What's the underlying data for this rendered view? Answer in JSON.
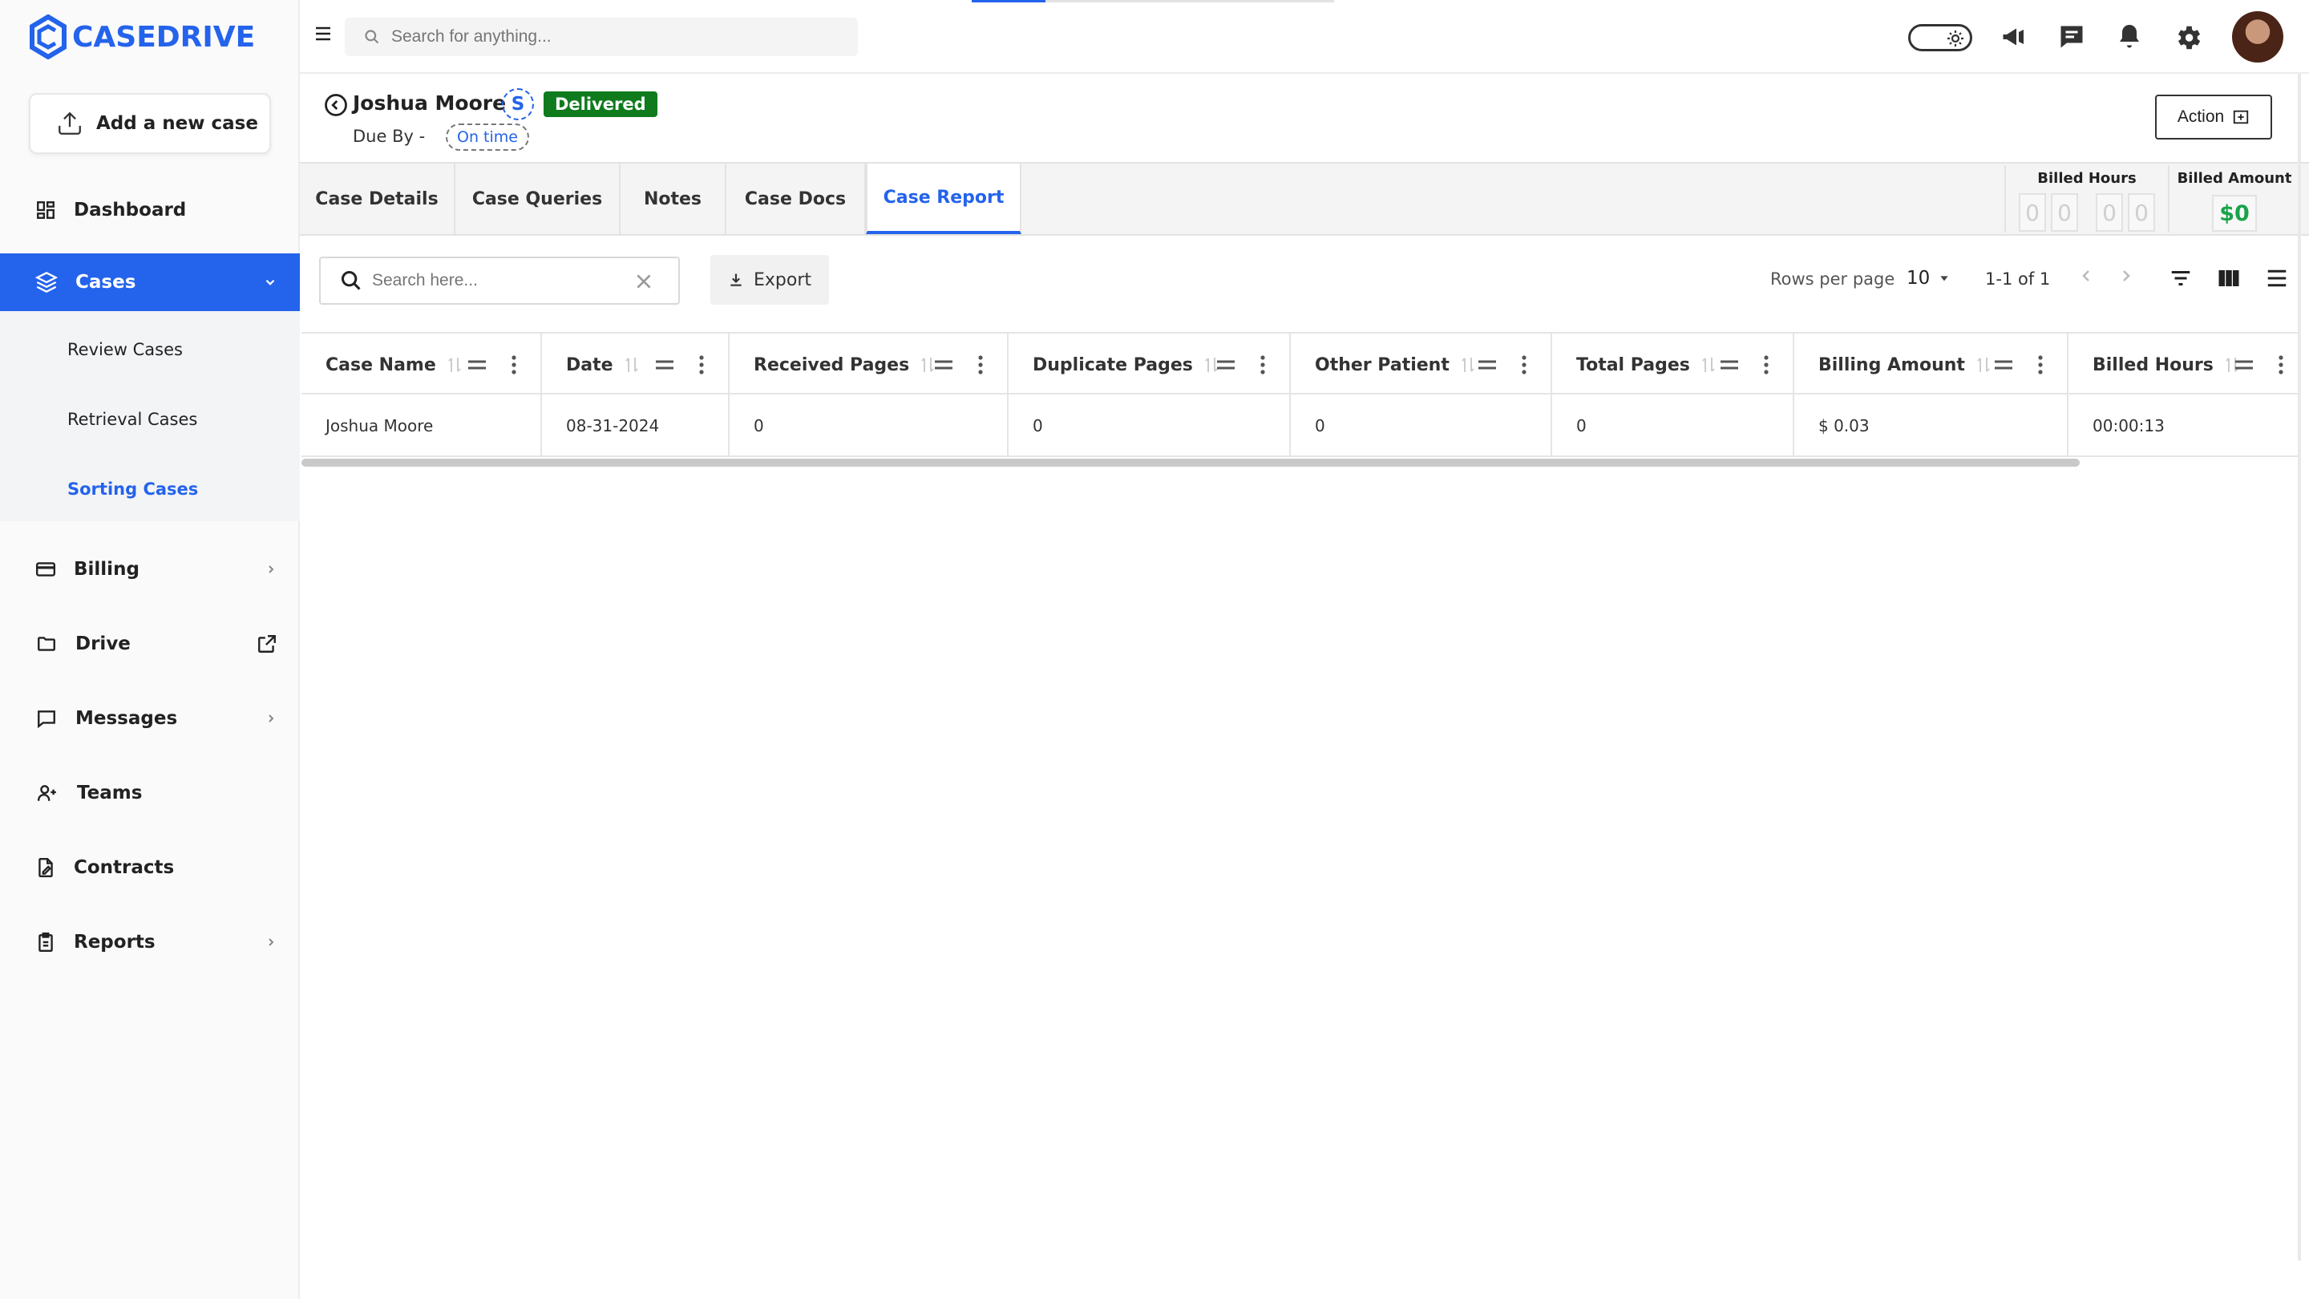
{
  "app": {
    "brand": "CASEDRIVE"
  },
  "sidebar": {
    "add_case_label": "Add a new case",
    "items": [
      {
        "label": "Dashboard",
        "icon": "dashboard-icon"
      },
      {
        "label": "Cases",
        "icon": "layers-icon",
        "active": true
      },
      {
        "label": "Billing",
        "icon": "credit-card-icon"
      },
      {
        "label": "Drive",
        "icon": "folder-icon"
      },
      {
        "label": "Messages",
        "icon": "message-icon"
      },
      {
        "label": "Teams",
        "icon": "users-icon"
      },
      {
        "label": "Contracts",
        "icon": "contract-icon"
      },
      {
        "label": "Reports",
        "icon": "clipboard-icon"
      }
    ],
    "cases_sub": [
      "Review Cases",
      "Retrieval Cases",
      "Sorting Cases"
    ],
    "active_sub": "Sorting Cases"
  },
  "topbar": {
    "search_placeholder": "Search for anything..."
  },
  "case": {
    "name": "Joshua Moore",
    "badge_letter": "S",
    "status": "Delivered",
    "due_by_label": "Due By -",
    "due_status": "On time",
    "action_label": "Action"
  },
  "tabs": [
    "Case Details",
    "Case Queries",
    "Notes",
    "Case Docs",
    "Case Report"
  ],
  "active_tab": "Case Report",
  "billed": {
    "hours_label": "Billed Hours",
    "hours_digits": [
      "0",
      "0",
      "0",
      "0"
    ],
    "amount_label": "Billed Amount",
    "amount_value": "$0"
  },
  "toolbar": {
    "search_placeholder": "Search here...",
    "export_label": "Export",
    "rows_per_page_label": "Rows per page",
    "rows_per_page_value": "10",
    "range_text": "1-1 of 1"
  },
  "table": {
    "columns": [
      "Case Name",
      "Date",
      "Received Pages",
      "Duplicate Pages",
      "Other Patient",
      "Total Pages",
      "Billing Amount",
      "Billed Hours"
    ],
    "rows": [
      [
        "Joshua Moore",
        "08-31-2024",
        "0",
        "0",
        "0",
        "0",
        "$ 0.03",
        "00:00:13"
      ]
    ]
  },
  "colors": {
    "accent": "#2463eb",
    "success": "#0f7b1d",
    "amount": "#1aa34a"
  }
}
